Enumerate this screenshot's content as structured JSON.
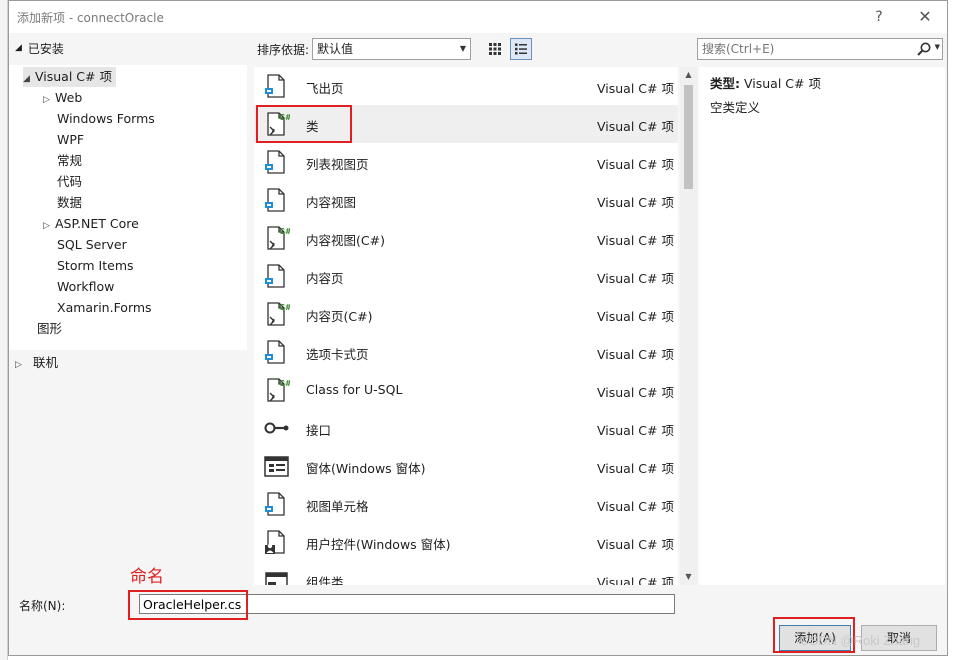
{
  "dialog": {
    "title": "添加新项 - connectOracle",
    "help_label": "?",
    "close_label": "✕"
  },
  "left_pane": {
    "installed_label": "已安装",
    "tree": [
      {
        "label": "Visual C# 项",
        "expander": "◢"
      },
      {
        "label": "Web",
        "expander": "▷"
      },
      {
        "label": "Windows Forms",
        "expander": ""
      },
      {
        "label": "WPF",
        "expander": ""
      },
      {
        "label": "常规",
        "expander": ""
      },
      {
        "label": "代码",
        "expander": ""
      },
      {
        "label": "数据",
        "expander": ""
      },
      {
        "label": "ASP.NET Core",
        "expander": "▷"
      },
      {
        "label": "SQL Server",
        "expander": ""
      },
      {
        "label": "Storm Items",
        "expander": ""
      },
      {
        "label": "Workflow",
        "expander": ""
      },
      {
        "label": "Xamarin.Forms",
        "expander": ""
      },
      {
        "label": "图形",
        "expander": ""
      }
    ],
    "online_label": "联机"
  },
  "sort_bar": {
    "label": "排序依据:",
    "selected": "默认值"
  },
  "search": {
    "placeholder": "搜索(Ctrl+E)"
  },
  "items": [
    {
      "name": "飞出页",
      "type": "Visual C# 项",
      "icon": "page-icon"
    },
    {
      "name": "类",
      "type": "Visual C# 项",
      "icon": "csharp-class-icon"
    },
    {
      "name": "列表视图页",
      "type": "Visual C# 项",
      "icon": "page-icon"
    },
    {
      "name": "内容视图",
      "type": "Visual C# 项",
      "icon": "page-icon"
    },
    {
      "name": "内容视图(C#)",
      "type": "Visual C# 项",
      "icon": "csharp-class-icon"
    },
    {
      "name": "内容页",
      "type": "Visual C# 项",
      "icon": "page-icon"
    },
    {
      "name": "内容页(C#)",
      "type": "Visual C# 项",
      "icon": "csharp-class-icon"
    },
    {
      "name": "选项卡式页",
      "type": "Visual C# 项",
      "icon": "page-icon"
    },
    {
      "name": "Class for U-SQL",
      "type": "Visual C# 项",
      "icon": "csharp-class-icon"
    },
    {
      "name": "接口",
      "type": "Visual C# 项",
      "icon": "interface-icon"
    },
    {
      "name": "窗体(Windows 窗体)",
      "type": "Visual C# 项",
      "icon": "form-icon"
    },
    {
      "name": "视图单元格",
      "type": "Visual C# 项",
      "icon": "page-icon"
    },
    {
      "name": "用户控件(Windows 窗体)",
      "type": "Visual C# 项",
      "icon": "user-control-icon"
    },
    {
      "name": "组件类",
      "type": "Visual C# 项",
      "icon": "component-icon"
    }
  ],
  "details": {
    "type_label": "类型:",
    "type_value": "Visual C# 项",
    "description": "空类定义"
  },
  "bottom": {
    "name_label": "名称(N):",
    "name_value": "OracleHelper.cs",
    "add_label": "添加(A)",
    "cancel_label": "取消"
  },
  "annotation": {
    "label": "命名",
    "color": "#e02020"
  },
  "watermark": "CSDN @Roki Zhang",
  "colors": {
    "selected_row": "#efefef",
    "csharp_green": "#3a8a2e",
    "icon_blue": "#1c8fd6"
  }
}
